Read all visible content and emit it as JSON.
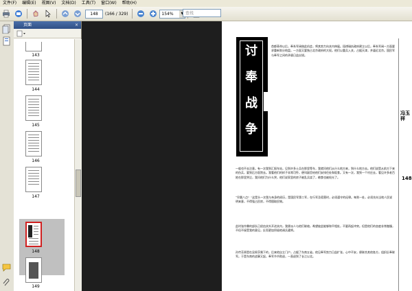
{
  "menu": [
    "文件(F)",
    "编辑(E)",
    "视图(V)",
    "文档(D)",
    "工具(T)",
    "窗口(W)",
    "帮助(H)"
  ],
  "toolbar": {
    "page_current": "148",
    "page_count": "(166 / 329)",
    "zoom": "154%",
    "search_placeholder": "查找"
  },
  "panel": {
    "title": "页面",
    "close": "×"
  },
  "thumbnails": [
    {
      "label": "143"
    },
    {
      "label": "144"
    },
    {
      "label": "145"
    },
    {
      "label": "146"
    },
    {
      "label": "147"
    },
    {
      "label": "148",
      "selected": true
    },
    {
      "label": "149"
    }
  ],
  "document": {
    "title_chars": [
      "讨",
      "奉",
      "战",
      "争"
    ],
    "side_note": "冯玉祥",
    "page_number": "148",
    "para1": "首都革命以后，奉系军阀借此机会，将其势力向关内伸展。段祺瑞执政府建立以后，奉系军阀一方面要求重新划分地盘，一方面又要独占北京政府的大权。他们以重兵入关，占据天津，并逼近北京。国民军与奉军之间的矛盾日益尖锐。",
    "para2": "一般也不去注意。有一次我到汇报车站，见到许多士兵在那里等车，我就问他们从什么地方来，到什么地方去。他们说是从前方下来的伤兵，要到后方医院去。我看他们的样子非常可怜，便叫副官给他们安排住处和饭食。又有一次，我到一个村庄去，看见许多老百姓在那里哭泣，我问他们为什么哭，他们说家里的房子被乱兵烧了，粮食也被抢光了。",
    "para3": "“早晨八点！”这是头一次我与亲身的经历，是国民军第二军，在行军及宿营时，必须遵守的纪律。每到一处，必须先向当地人民说明来意，不得强占民房，不得擅取民物。",
    "para4": "此时张作霖的部队已经由关外开进关内，我便派人与他们联络，希望彼此能够和平相处，不要再起冲突。但是他们的态度非常傲慢，不但不接受我的意见，反而更加积极地调兵遣将。",
    "para5": "孙传芳原是在吴佩孚属下的，后来他自立门户，占据了东南五省。他见奉军势力日益扩张，心中不安，便联合其他各方，组织反奉联军。于是东南的战事又起，奉军节节败退，一直退到了长江以北。"
  }
}
